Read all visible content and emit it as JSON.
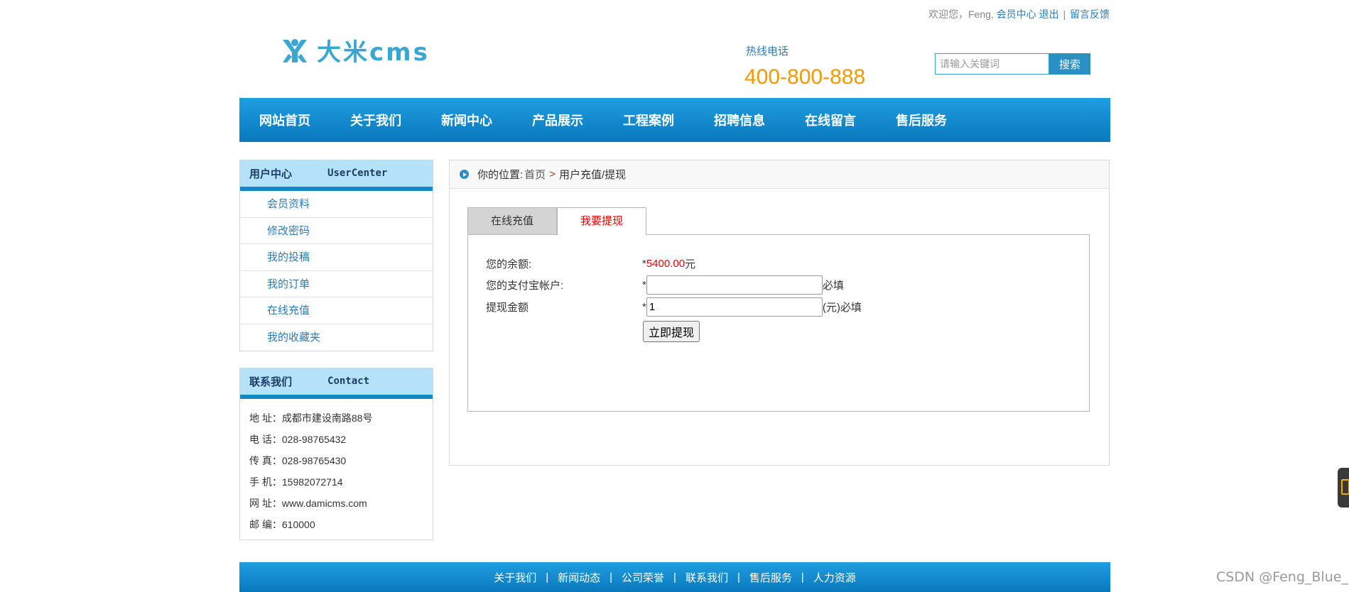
{
  "topbar": {
    "welcome": "欢迎您，Feng,",
    "member_center": "会员中心",
    "logout": "退出",
    "sep": "|",
    "feedback": "留言反馈"
  },
  "header": {
    "logo_text": "大米cms",
    "hotline_label": "热线电话",
    "hotline_number": "400-800-888",
    "search_placeholder": "请输入关键词",
    "search_button": "搜索"
  },
  "nav": [
    "网站首页",
    "关于我们",
    "新闻中心",
    "产品展示",
    "工程案例",
    "招聘信息",
    "在线留言",
    "售后服务"
  ],
  "user_center": {
    "title": "用户中心",
    "title_en": "UserCenter",
    "items": [
      "会员资料",
      "修改密码",
      "我的投稿",
      "我的订单",
      "在线充值",
      "我的收藏夹"
    ]
  },
  "contact": {
    "title": "联系我们",
    "title_en": "Contact",
    "rows": [
      "地  址：成都市建设南路88号",
      "电  话：028-98765432",
      "传  真：028-98765430",
      "手  机：15982072714",
      "网  址：www.damicms.com",
      "邮  编：610000"
    ]
  },
  "breadcrumb": {
    "prefix": "你的位置:",
    "home": "首页",
    "gt": ">",
    "current": "用户充值/提现"
  },
  "tabs": {
    "recharge": "在线充值",
    "withdraw": "我要提现"
  },
  "form": {
    "balance_label": "您的余额:",
    "required_mark": "*",
    "balance_value": "5400.00",
    "balance_unit": "元",
    "alipay_label": "您的支付宝帐户:",
    "alipay_value": "",
    "alipay_hint": "必填",
    "amount_label": "提现金额",
    "amount_value": "1",
    "amount_hint": "(元)必填",
    "submit": "立即提现"
  },
  "footer": {
    "links": [
      "关于我们",
      "新闻动态",
      "公司荣誉",
      "联系我们",
      "售后服务",
      "人力资源"
    ],
    "sep": "|"
  },
  "watermark": "CSDN @Feng_Blue_",
  "colors": {
    "nav_blue": "#0a78bd",
    "accent_orange": "#f39800",
    "link_blue": "#2b7bb9",
    "sidebar_head": "#b5e2f8",
    "alert_red": "#e00000"
  }
}
